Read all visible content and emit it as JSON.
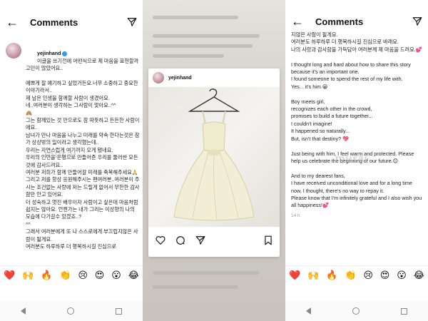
{
  "header": {
    "title": "Comments",
    "back_icon": "arrow-left-icon",
    "send_icon": "paper-plane-icon"
  },
  "post": {
    "username": "yejinhand",
    "time_ago": "14 h"
  },
  "caption_korean": [
    "이글을 쓰기전에 어떤식으로 제 마음을 표현할까 고민이 많았어요..",
    "예쁘게 잘 얘기하고 싶었거든요.너무 소중하고 중요한 이야기라서..",
    "제 남은 인생을 함께할 사람이 생겼어요.",
    "네..여러분이 생각하는 그사람이 맞아요..^^",
    "🙈",
    "그는 함께있는 것 만으로도 참 따뜻하고 든든한 사람이에요.",
    "",
    "남녀가 만나 마음을 나누고 미래를 약속 한다는것은 참가 상상밖의 일이라고 생각했는데..",
    "우리는 자연스럽게 여기까지 오게 됐네요.",
    "우리의 인연을 운명으로 만들어준 우리를 둘러싼 모든것에 감사드려요..",
    "여러분 저희가 함께 만들어갈 미래를 축복해주세요🙏",
    "",
    "그리고 저를 항상 응원해주시는 팬여러분..여러분이 주시는 조건없는 사랑에 저는 드릴게 없어서 무한한 감사함만 안고 있어요.",
    "더 성숙하고 멋진 배우이자 사람이고 싶은데 마음처럼 쉽지는 않아요. 언젠가는 내가 그리는 이상향의 나의 모습에 다가갈수 있겠죠..?",
    "^^",
    "그래서 여러분에게 또 나 스스로에게 부끄럽지않은 사람이 될게요.",
    "여러분도 하루하루 더 행복하시길 진심으로"
  ],
  "caption_p3_korean": [
    "지않은 사람이 될게요.",
    "여러분도 하루하루 더 행복하시길 진심으로 바래요.",
    "나의 사랑과 감사함을 가득담아 여러분께 제 마음을 드려요.💕"
  ],
  "caption_english": [
    "I thought long and hard about how to share this story because it's an important one.",
    "I found someone to spend the rest of my life with.",
    "Yes... it's him.😀",
    "",
    "Boy meets girl,",
    "recognizes each other in the crowd,",
    "promises to build a future together...",
    "I couldn't imagine!",
    "It happened so naturally...",
    "But, isn't that destiny? 💖",
    "",
    "Just being with him, I feel warm and protected. Please help us celebrate the beginning of our future.😊",
    "",
    "And to my dearest fans,",
    "I have received unconditional love and for a long time now, I thought, there's no way to repay it.",
    "Please know that I'm infinitely grateful and I also wish you all happiness!💕"
  ],
  "emoji_bar": [
    "❤️",
    "🙌",
    "🔥",
    "👏",
    "😢",
    "😍",
    "😮",
    "😂"
  ],
  "watermark": "murai",
  "card_actions": [
    "heart-icon",
    "comment-icon",
    "share-icon",
    "bookmark-icon"
  ]
}
